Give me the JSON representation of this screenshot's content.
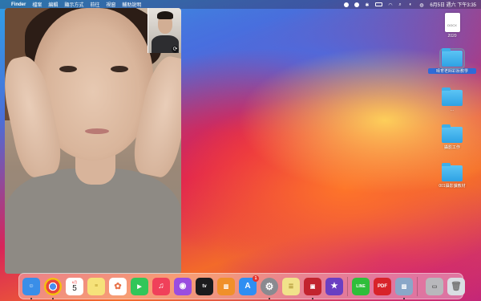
{
  "menubar": {
    "apple": "",
    "app_name": "Finder",
    "menus": [
      "檔案",
      "編輯",
      "顯示方式",
      "前往",
      "視窗",
      "輔助說明"
    ],
    "clock": "6月5日 週六 下午3:35"
  },
  "video": {
    "rotate_symbol": "⟳"
  },
  "desktop": {
    "items": [
      {
        "label": "2020",
        "kind": "document",
        "doc_text": "DOCX"
      },
      {
        "label": "晴育老師彩妝教學",
        "kind": "folder",
        "selected": true
      },
      {
        "label": "...",
        "kind": "folder"
      },
      {
        "label": "攝影工作",
        "kind": "folder"
      },
      {
        "label": "001攝影課教材",
        "kind": "folder"
      }
    ]
  },
  "dock": {
    "calendar_month": "6月",
    "calendar_day": "5",
    "appstore_badge": "1",
    "apps": [
      {
        "name": "finder",
        "color": "#3a8ee8",
        "glyph": "☺"
      },
      {
        "name": "chrome",
        "color": "#e8e8e8",
        "glyph": "◎"
      },
      {
        "name": "calendar",
        "color": "#ffffff",
        "glyph": ""
      },
      {
        "name": "notes",
        "color": "#f6e27a",
        "glyph": "≡"
      },
      {
        "name": "photos",
        "color": "#ffffff",
        "glyph": "✿"
      },
      {
        "name": "facetime",
        "color": "#31c659",
        "glyph": "▶"
      },
      {
        "name": "music",
        "color": "#f0405a",
        "glyph": "♫"
      },
      {
        "name": "podcasts",
        "color": "#9a4de0",
        "glyph": "◉"
      },
      {
        "name": "apple-tv",
        "color": "#1b1b1d",
        "glyph": "tv"
      },
      {
        "name": "books",
        "color": "#f0902a",
        "glyph": "▥"
      },
      {
        "name": "app-store",
        "color": "#2f8ef2",
        "glyph": "A"
      },
      {
        "name": "system-preferences",
        "color": "#8a8a90",
        "glyph": "⚙"
      },
      {
        "name": "stickies",
        "color": "#f1e28a",
        "glyph": "☰"
      },
      {
        "name": "photo-booth",
        "color": "#c2242e",
        "glyph": "▣"
      },
      {
        "name": "imovie",
        "color": "#6a3fc2",
        "glyph": "★"
      },
      {
        "name": "line",
        "color": "#2fbe3a",
        "glyph": "LINE"
      },
      {
        "name": "pdf",
        "color": "#d8232a",
        "glyph": "PDF"
      },
      {
        "name": "preview",
        "color": "#8aa7c8",
        "glyph": "▨"
      },
      {
        "name": "screen-recorder",
        "color": "#b8b8bc",
        "glyph": "▭"
      },
      {
        "name": "trash",
        "color": "#d9dde3",
        "glyph": "🗑"
      }
    ]
  }
}
